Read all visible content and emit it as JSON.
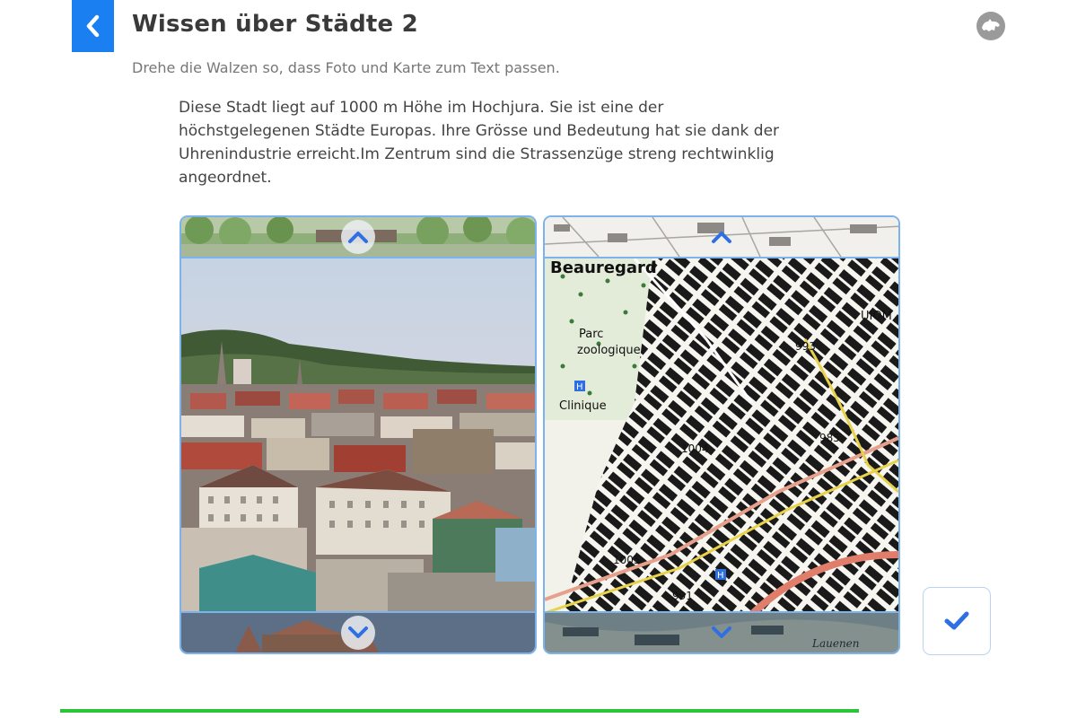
{
  "header": {
    "title": "Wissen über Städte 2",
    "subtitle": "Drehe die Walzen so, dass Foto und Karte zum Text passen."
  },
  "question": {
    "text": "Diese Stadt liegt auf 1000 m Höhe im Hochjura. Sie ist eine der höchstgelegenen Städte Europas. Ihre Grösse und Bedeutung hat sie dank der Uhrenindustrie erreicht.Im Zentrum sind die Strassenzüge streng rechtwinklig angeordnet."
  },
  "map_labels": {
    "beauregard": "Beauregard",
    "parc": "Parc",
    "zoologique": "zoologique",
    "clinique": "Clinique",
    "uiom": "UIOM",
    "alt_993": "993",
    "alt_985": "985",
    "alt_1004": "1004",
    "alt_1005": "1005",
    "alt_991": "991",
    "lauenen": "Lauenen",
    "hospital_h": "H"
  },
  "icons": {
    "back": "chevron-left-icon",
    "up": "chevron-up-icon",
    "down": "chevron-down-icon",
    "check": "checkmark-icon",
    "mascot": "mascot-icon"
  },
  "colors": {
    "accent": "#1a7ff0",
    "arrow": "#2f6fe4",
    "reel_border": "#7cb3ec",
    "progress": "#2cc53a"
  },
  "progress": {
    "fraction": 1.0
  }
}
